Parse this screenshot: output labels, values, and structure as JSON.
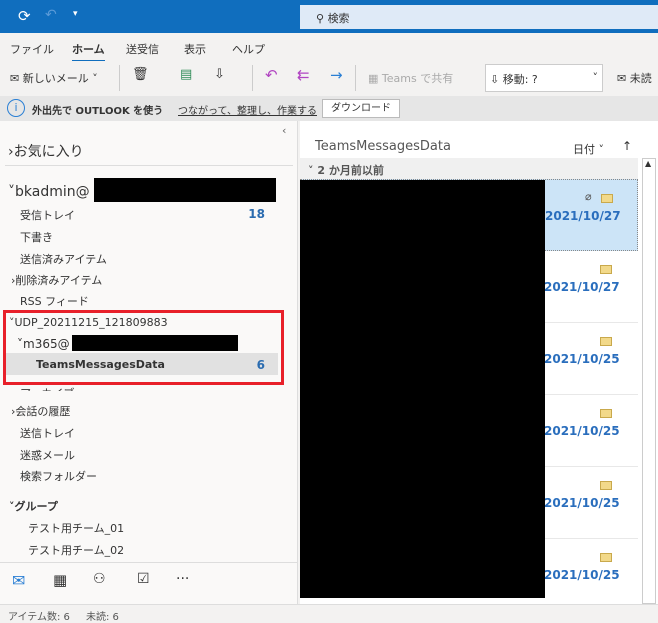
{
  "titlebar": {
    "search_placeholder": "検索"
  },
  "ribbon": {
    "tabs": [
      "ファイル",
      "ホーム",
      "送受信",
      "表示",
      "ヘルプ"
    ]
  },
  "toolbar": {
    "new_mail": "新しいメール",
    "teams_share": "Teams で共有",
    "move": "移動: ?",
    "unread": "未読"
  },
  "infobar": {
    "title": "外出先で OUTLOOK を使う",
    "link": "つながって、整理し、作業する",
    "download": "ダウンロード"
  },
  "sidebar": {
    "favorites": "お気に入り",
    "account": "bkadmin@",
    "folders": [
      {
        "label": "受信トレイ",
        "count": "18"
      },
      {
        "label": "下書き"
      },
      {
        "label": "送信済みアイテム"
      },
      {
        "label": "削除済みアイテム"
      },
      {
        "label": "RSS フィード"
      }
    ],
    "pst": "UDP_20211215_121809883",
    "sub_account": "m365@",
    "selected_folder": {
      "label": "TeamsMessagesData",
      "count": "6"
    },
    "more_folders": [
      "アーカイブ",
      "会話の履歴",
      "送信トレイ",
      "迷惑メール",
      "検索フォルダー"
    ],
    "groups_title": "グループ",
    "groups": [
      "テスト用チーム_01",
      "テスト用チーム_02"
    ]
  },
  "list": {
    "title": "TeamsMessagesData",
    "sort": "日付",
    "group_header": "2 か月前以前",
    "messages": [
      {
        "date": "2021/10/27"
      },
      {
        "date": "2021/10/27"
      },
      {
        "date": "2021/10/25"
      },
      {
        "date": "2021/10/25"
      },
      {
        "date": "2021/10/25"
      },
      {
        "date": "2021/10/25"
      }
    ]
  },
  "status": {
    "items": "アイテム数: 6",
    "unread": "未読: 6"
  }
}
